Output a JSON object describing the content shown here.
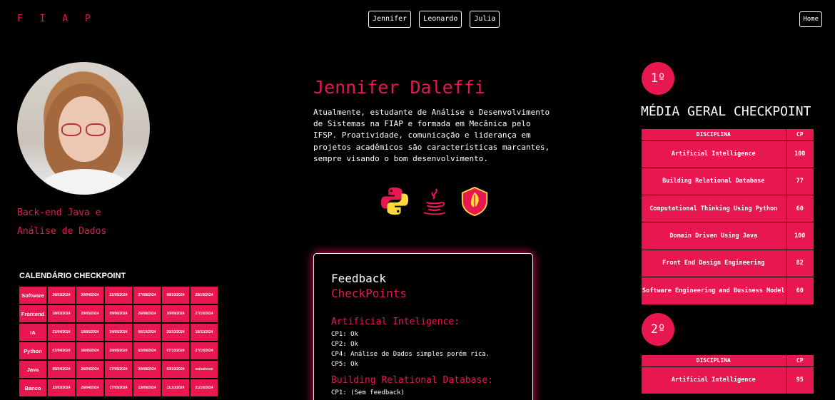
{
  "header": {
    "logo": "F I A P",
    "nav": [
      "Jennifer",
      "Leonardo",
      "Julia"
    ],
    "home": "Home"
  },
  "profile": {
    "role_line1": "Back-end Java e",
    "role_line2": "Análise de Dados",
    "name": "Jennifer Daleffi",
    "bio": "Atualmente, estudante de Análise e Desenvolvimento de Sistemas na FIAP e formada em Mecânica pelo IFSP. Proatividade, comunicação e liderança em projetos acadêmicos são características marcantes, sempre visando o bom desenvolvimento.",
    "skill_icons": [
      "python-icon",
      "java-icon",
      "spring-icon"
    ]
  },
  "calendar": {
    "title": "CALENDÁRIO CHECKPOINT",
    "rows": [
      {
        "subject": "Software",
        "dates": [
          "26/03/2024",
          "30/04/2024",
          "21/05/2024",
          "27/08/2024",
          "08/10/2024",
          "29/10/2024"
        ]
      },
      {
        "subject": "Frontend",
        "dates": [
          "18/03/2024",
          "29/05/2024",
          "09/06/2024",
          "26/08/2024",
          "30/09/2024",
          "27/10/2024"
        ]
      },
      {
        "subject": "IA",
        "dates": [
          "21/04/2024",
          "10/05/2024",
          "24/05/2024",
          "06/10/2024",
          "20/10/2024",
          "10/11/2024"
        ]
      },
      {
        "subject": "Python",
        "dates": [
          "01/04/2024",
          "16/05/2024",
          "20/05/2024",
          "02/09/2024",
          "07/10/2024",
          "27/10/2024"
        ]
      },
      {
        "subject": "Java",
        "dates": [
          "05/04/2024",
          "26/04/2024",
          "17/05/2024",
          "30/08/2024",
          "03/10/2024",
          "xx/xx/xxxx"
        ]
      },
      {
        "subject": "Banco",
        "dates": [
          "22/03/2024",
          "26/04/2024",
          "17/05/2024",
          "13/09/2024",
          "11/10/2024",
          "31/10/2024"
        ]
      }
    ]
  },
  "feedback": {
    "title": "Feedback",
    "subtitle": "CheckPoints",
    "sections": [
      {
        "heading": "Artificial Inteligence:",
        "lines": [
          "CP1: Ok",
          "CP2: Ok",
          "CP4: Análise de Dados simples porém rica.",
          "CP5: Ok"
        ]
      },
      {
        "heading": "Building Relational Database:",
        "lines": [
          "CP1: (Sem feedback)"
        ]
      }
    ]
  },
  "rankings": {
    "rank1": "1º",
    "media_title": "MÉDIA GERAL CHECKPOINT",
    "rank2": "2º",
    "col_discipline": "DISCIPLINA",
    "col_cp": "CP",
    "table1": [
      {
        "discipline": "Artificial Intelligence",
        "cp": "100"
      },
      {
        "discipline": "Building Relational Database",
        "cp": "77"
      },
      {
        "discipline": "Computational Thinking Using Python",
        "cp": "60"
      },
      {
        "discipline": "Domain Driven Using Java",
        "cp": "100"
      },
      {
        "discipline": "Front End Design Engineering",
        "cp": "82"
      },
      {
        "discipline": "Software Engineering and Business Model",
        "cp": "60"
      }
    ],
    "table2": [
      {
        "discipline": "Artificial Intelligence",
        "cp": "95"
      }
    ]
  }
}
